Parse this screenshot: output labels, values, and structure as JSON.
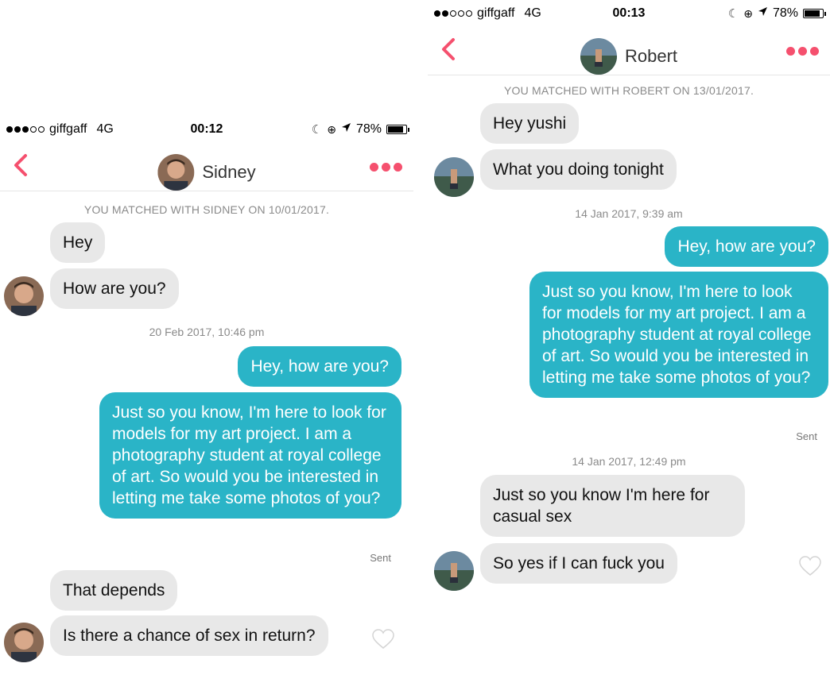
{
  "left": {
    "status": {
      "carrier": "giffgaff",
      "network": "4G",
      "time": "00:12",
      "battery": "78%",
      "battery_level": 0.78
    },
    "header": {
      "name": "Sidney"
    },
    "match_note": "YOU MATCHED WITH SIDNEY ON 10/01/2017.",
    "messages": [
      {
        "text": "Hey"
      },
      {
        "text": "How are you?"
      },
      {
        "timestamp": "20 Feb 2017, 10:46 pm"
      },
      {
        "text": "Hey, how are you?"
      },
      {
        "text": "Just so you know, I'm here to look for models for my art project. I am a photography student at royal college of art. So would you be interested in letting me take some photos of you?"
      },
      {
        "status": "Sent"
      },
      {
        "text": "That depends"
      },
      {
        "text": "Is there a chance of sex in return?"
      }
    ]
  },
  "right": {
    "status": {
      "carrier": "giffgaff",
      "network": "4G",
      "time": "00:13",
      "battery": "78%",
      "battery_level": 0.78
    },
    "header": {
      "name": "Robert"
    },
    "match_note": "YOU MATCHED WITH ROBERT ON 13/01/2017.",
    "messages": [
      {
        "text": "Hey yushi"
      },
      {
        "text": "What you doing tonight"
      },
      {
        "timestamp": "14 Jan 2017, 9:39 am"
      },
      {
        "text": "Hey, how are you?"
      },
      {
        "text": "Just so you know, I'm here to look for models for my art project. I am a photography student at royal college of art. So would you be interested in letting me take some photos of you?"
      },
      {
        "status": "Sent"
      },
      {
        "timestamp": "14 Jan 2017, 12:49 pm"
      },
      {
        "text": "Just so you know I'm here for casual sex"
      },
      {
        "text": "So yes if I can fuck you"
      }
    ]
  },
  "colors": {
    "accent": "#f5506e",
    "outgoing_bubble": "#2ab4c7",
    "incoming_bubble": "#e8e8e8"
  }
}
